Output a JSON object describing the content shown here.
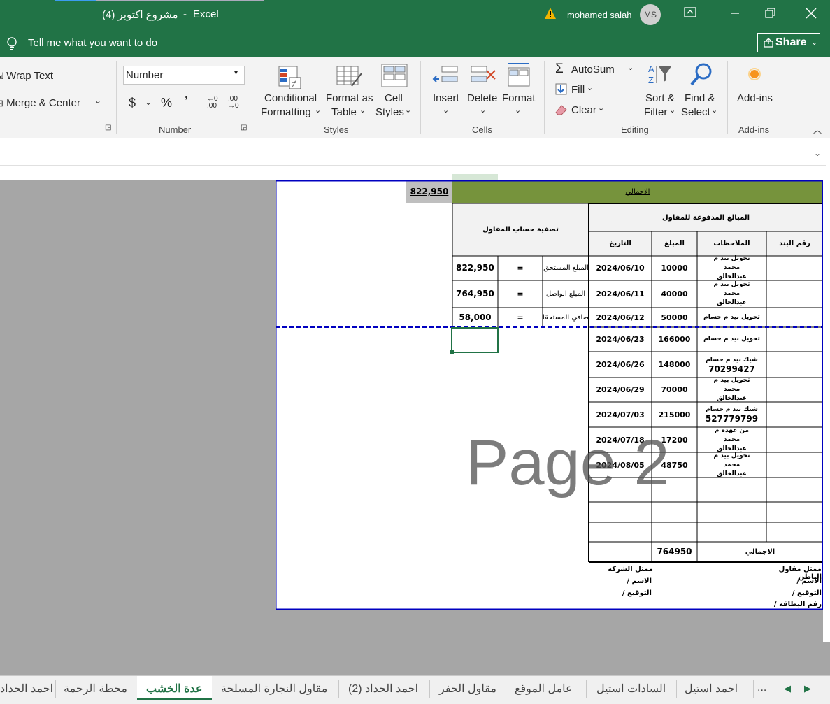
{
  "window": {
    "file_name": "مشروع اكتوبر (4)",
    "separator": "-",
    "app_name": "Excel",
    "user_name": "mohamed salah",
    "user_initials": "MS"
  },
  "tell_me": {
    "placeholder": "Tell me what you want to do"
  },
  "share": {
    "label": "Share"
  },
  "ribbon": {
    "alignment": {
      "wrap_text": "Wrap Text",
      "merge_center": "Merge & Center"
    },
    "number": {
      "format_value": "Number",
      "currency": "$",
      "percent": "%",
      "comma": "’",
      "increase_decimal": "←0 .00",
      "decrease_decimal": ".00 →0",
      "group_label": "Number"
    },
    "styles": {
      "conditional_1": "Conditional",
      "conditional_2": "Formatting",
      "format_table_1": "Format as",
      "format_table_2": "Table",
      "cell_styles_1": "Cell",
      "cell_styles_2": "Styles",
      "group_label": "Styles"
    },
    "cells": {
      "insert": "Insert",
      "delete": "Delete",
      "format": "Format",
      "group_label": "Cells"
    },
    "editing": {
      "autosum": "AutoSum",
      "fill": "Fill",
      "clear": "Clear",
      "sort_1": "Sort &",
      "sort_2": "Filter",
      "find_1": "Find &",
      "find_2": "Select",
      "group_label": "Editing"
    },
    "addins": {
      "label": "Add-ins",
      "group_label": "Add-ins"
    }
  },
  "sheet": {
    "total_top_value": "822,950",
    "total_header": "الاجمالي",
    "payments_header": "المبالغ المدفوعة للمقاول",
    "settlement_header": "تصفية حساب المقاول",
    "col_item": "رقم البند",
    "col_notes": "الملاحظات",
    "col_amount": "المبلغ",
    "col_date": "التاريخ",
    "rows": [
      {
        "notes": "تحويل بيد م محمد عبدالخالق",
        "amount": "10000",
        "date": "2024/06/10"
      },
      {
        "notes": "تحويل بيد م محمد عبدالخالق",
        "amount": "40000",
        "date": "2024/06/11"
      },
      {
        "notes": "تحويل بيد م حسام",
        "amount": "50000",
        "date": "2024/06/12"
      },
      {
        "notes": "تحويل بيد م حسام",
        "amount": "166000",
        "date": "2024/06/23"
      },
      {
        "notes": "شيك بيد م حسام",
        "notes_number": "70299427",
        "amount": "148000",
        "date": "2024/06/26"
      },
      {
        "notes": "تحويل بيد م محمد عبدالخالق",
        "amount": "70000",
        "date": "2024/06/29"
      },
      {
        "notes": "شيك بيد م حسام",
        "notes_number": "527779799",
        "amount": "215000",
        "date": "2024/07/03"
      },
      {
        "notes": "من عهدة م محمد عبدالخالق",
        "amount": "17200",
        "date": "2024/07/18"
      },
      {
        "notes": "تحويل بيد م محمد عبدالخالق",
        "amount": "48750",
        "date": "2024/08/05"
      }
    ],
    "total_label": "الاجمالي",
    "total_value": "764950",
    "settlement": [
      {
        "label": "المبلغ المستحق",
        "eq": "=",
        "value": "822,950"
      },
      {
        "label": "المبلغ الواصل",
        "eq": "=",
        "value": "764,950"
      },
      {
        "label": "صافي المستحقات",
        "eq": "=",
        "value": "58,000"
      }
    ],
    "watermark": "Page 2",
    "company_rep": "ممثل الشركة",
    "name_label": "الاسم /",
    "signature_label": "التوقيع /",
    "subcontractor_rep": "ممثل مقاول الباطن",
    "sub_name": "الاسم /",
    "sub_signature": "التوقيع /",
    "id_card": "رقم البطاقة /"
  },
  "tabs": {
    "ellipsis": "...",
    "items": [
      "احمد استيل",
      "السادات استيل",
      "عامل الموقع",
      "مقاول الحفر",
      "احمد الحداد (2)",
      "مقاول النجارة المسلحة",
      "عدة الخشب",
      "محطة الرحمة",
      "احمد الحداد"
    ],
    "active_index": 6
  },
  "colors": {
    "excel_green": "#217346",
    "header_green": "#76933c",
    "print_border": "#0000c0"
  }
}
